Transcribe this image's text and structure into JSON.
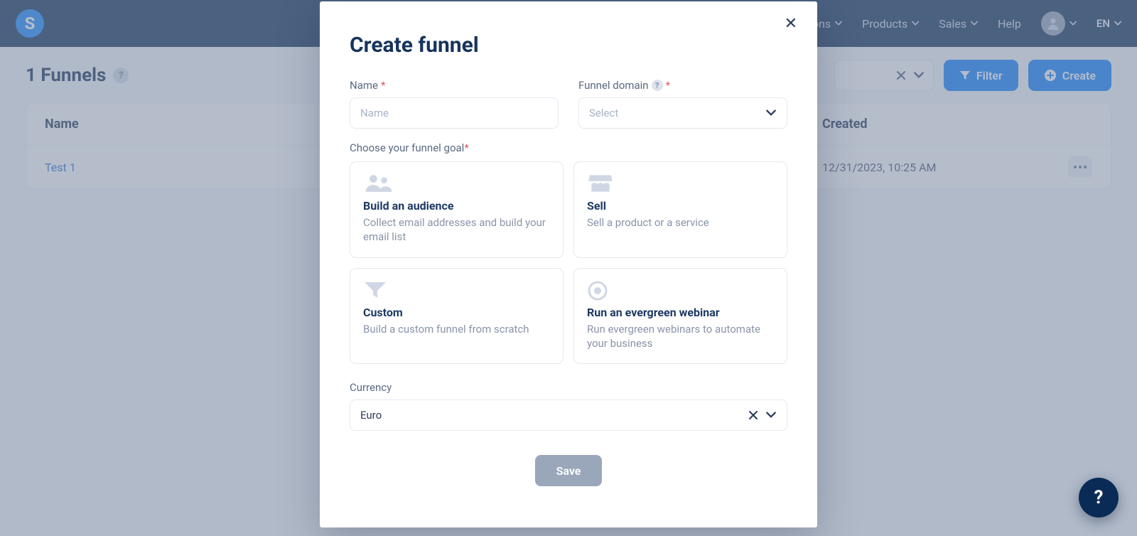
{
  "nav": {
    "items": [
      "…tions",
      "Products",
      "Sales",
      "Help"
    ],
    "lang": "EN"
  },
  "page": {
    "title": "1 Funnels",
    "filter_label": "Filter",
    "create_label": "Create"
  },
  "table": {
    "col_name": "Name",
    "col_created": "Created",
    "rows": [
      {
        "name": "Test 1",
        "created": "12/31/2023, 10:25 AM"
      }
    ]
  },
  "modal": {
    "title": "Create funnel",
    "name_label": "Name",
    "name_placeholder": "Name",
    "domain_label": "Funnel domain",
    "domain_placeholder": "Select",
    "goal_label": "Choose your funnel goal",
    "goals": [
      {
        "title": "Build an audience",
        "desc": "Collect email addresses and build your email list"
      },
      {
        "title": "Sell",
        "desc": "Sell a product or a service"
      },
      {
        "title": "Custom",
        "desc": "Build a custom funnel from scratch"
      },
      {
        "title": "Run an evergreen webinar",
        "desc": "Run evergreen webinars to automate your business"
      }
    ],
    "currency_label": "Currency",
    "currency_value": "Euro",
    "save_label": "Save"
  }
}
